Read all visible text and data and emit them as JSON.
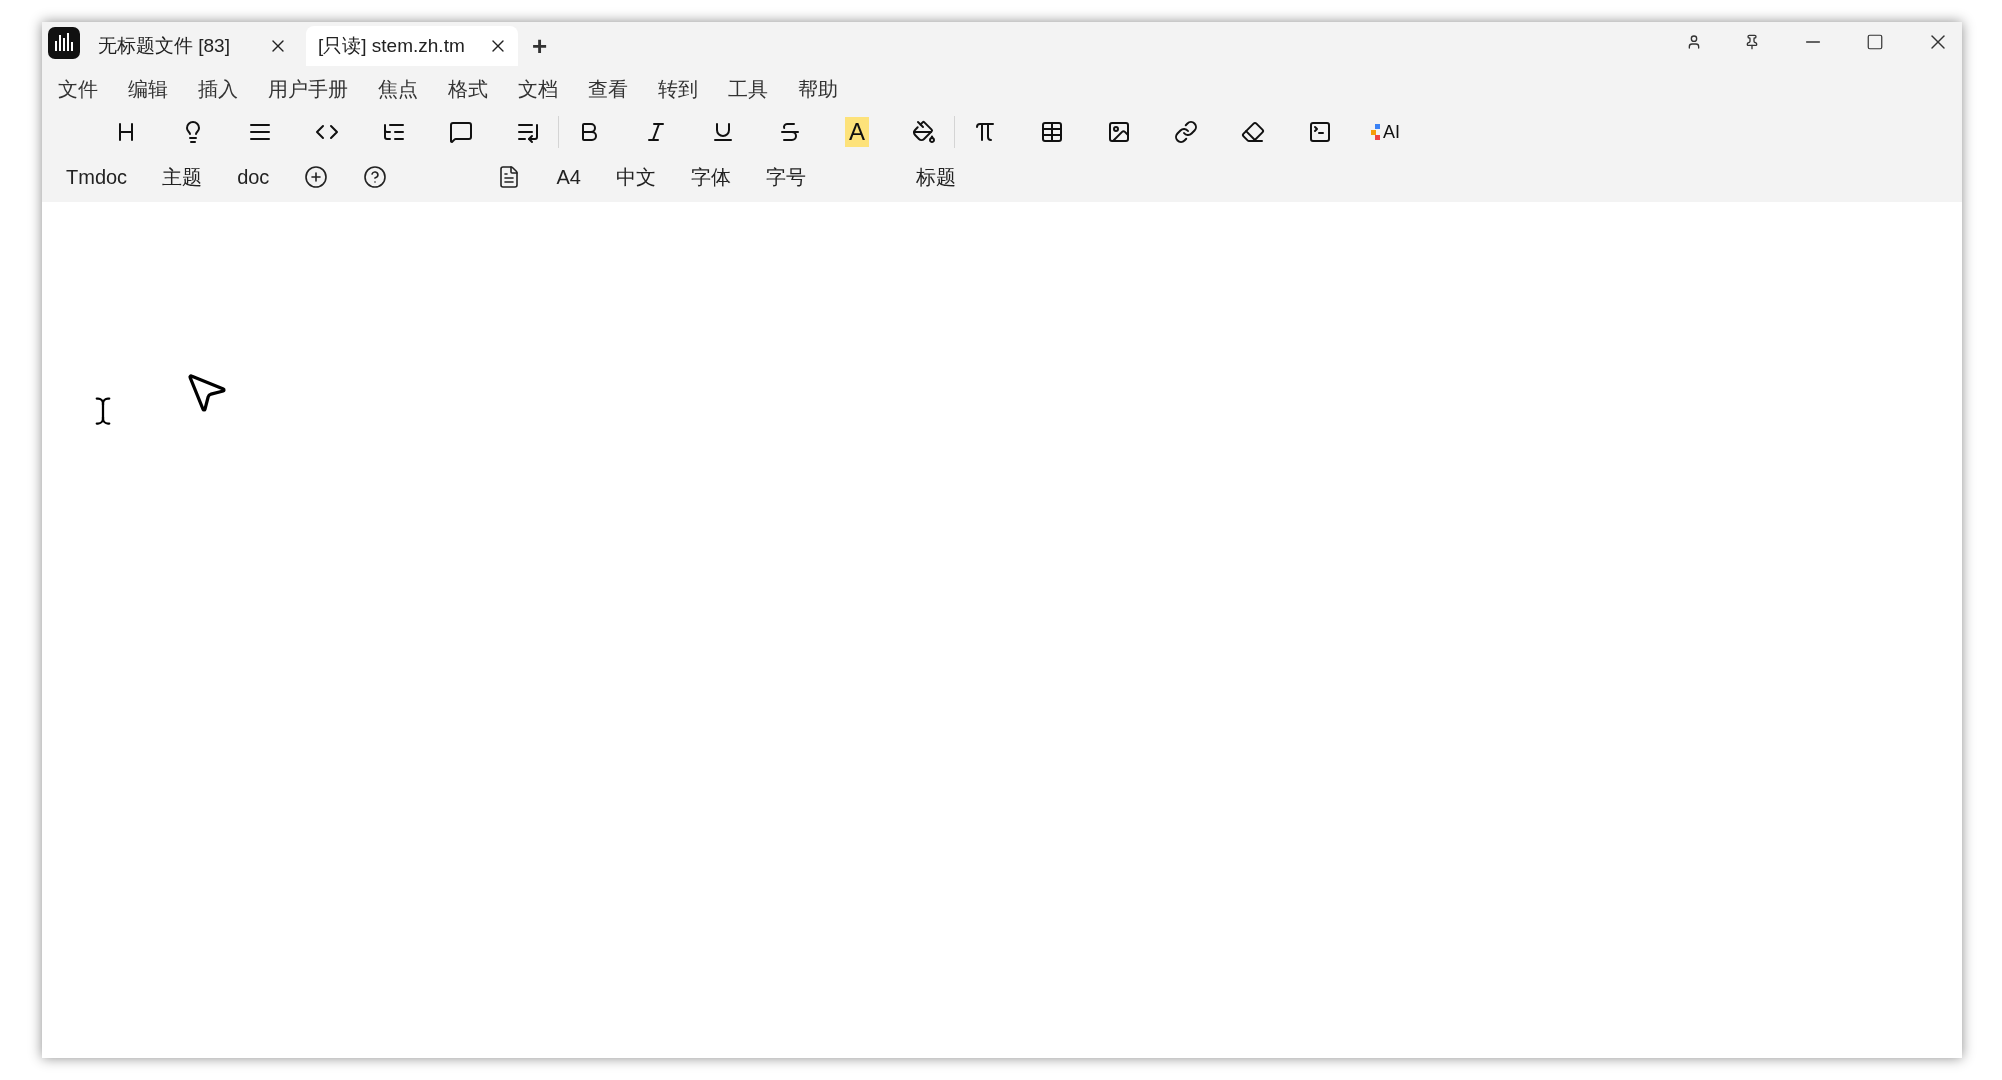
{
  "tabs": [
    {
      "label": "无标题文件 [83]",
      "selected": false
    },
    {
      "label": "[只读] stem.zh.tm",
      "selected": true
    }
  ],
  "new_tab": "+",
  "menu": [
    "文件",
    "编辑",
    "插入",
    "用户手册",
    "焦点",
    "格式",
    "文档",
    "查看",
    "转到",
    "工具",
    "帮助"
  ],
  "toolbar": [
    [
      {
        "kind": "icon"
      },
      {
        "kind": "icon"
      },
      {
        "kind": "icon"
      },
      {
        "kind": "icon"
      },
      {
        "kind": "icon"
      },
      {
        "kind": "icon"
      },
      {
        "kind": "icon"
      }
    ],
    [
      {
        "kind": "icon"
      },
      {
        "kind": "icon"
      },
      {
        "kind": "icon"
      },
      {
        "kind": "icon"
      },
      {
        "kind": "highlight",
        "label": "A"
      },
      {
        "kind": "icon"
      }
    ],
    [
      {
        "kind": "icon"
      },
      {
        "kind": "icon"
      },
      {
        "kind": "icon"
      },
      {
        "kind": "icon"
      },
      {
        "kind": "icon"
      },
      {
        "kind": "icon"
      },
      {
        "kind": "ai",
        "label": "AI"
      }
    ]
  ],
  "docbar": [
    {
      "kind": "text",
      "label": "Tmdoc"
    },
    {
      "kind": "text",
      "label": "主题"
    },
    {
      "kind": "text",
      "label": "doc"
    },
    {
      "kind": "icon"
    },
    {
      "kind": "icon"
    },
    {
      "kind": "gap"
    },
    {
      "kind": "icon"
    },
    {
      "kind": "text",
      "label": "A4"
    },
    {
      "kind": "text",
      "label": "中文"
    },
    {
      "kind": "text",
      "label": "字体"
    },
    {
      "kind": "text",
      "label": "字号"
    },
    {
      "kind": "gap"
    },
    {
      "kind": "text",
      "label": "标题"
    }
  ]
}
